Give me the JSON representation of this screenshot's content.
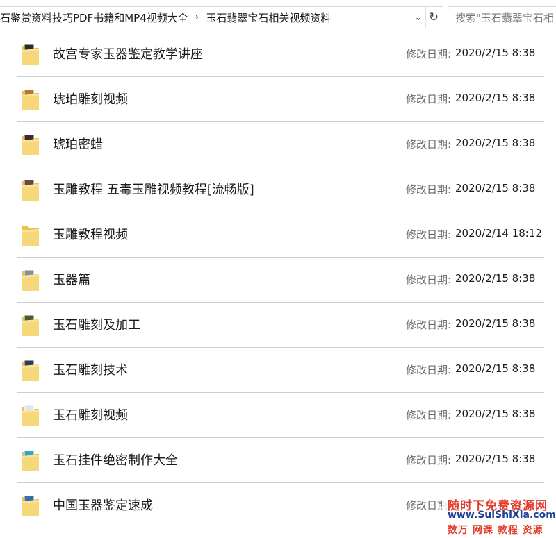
{
  "address_bar": {
    "breadcrumbs": [
      "石鉴赏资料技巧PDF书籍和MP4视频大全",
      "玉石翡翠宝石相关视频资料"
    ],
    "separator": "›",
    "dropdown_glyph": "⌄",
    "refresh_glyph": "↻"
  },
  "search": {
    "placeholder": "搜索\"玉石翡翠宝石相"
  },
  "file_list": {
    "modified_label": "修改日期:",
    "items": [
      {
        "name": "故宫专家玉器鉴定教学讲座",
        "modified": "2020/2/15 8:38",
        "icon": "folder-video-icon"
      },
      {
        "name": "琥珀雕刻视频",
        "modified": "2020/2/15 8:38",
        "icon": "folder-video-icon"
      },
      {
        "name": "琥珀密蜡",
        "modified": "2020/2/15 8:38",
        "icon": "folder-video-icon"
      },
      {
        "name": "玉雕教程 五毒玉雕视频教程[流畅版]",
        "modified": "2020/2/15 8:38",
        "icon": "folder-video-icon"
      },
      {
        "name": "玉雕教程视频",
        "modified": "2020/2/14 18:12",
        "icon": "folder-icon"
      },
      {
        "name": "玉器篇",
        "modified": "2020/2/15 8:38",
        "icon": "folder-image-icon"
      },
      {
        "name": "玉石雕刻及加工",
        "modified": "2020/2/15 8:38",
        "icon": "folder-video-icon"
      },
      {
        "name": "玉石雕刻技术",
        "modified": "2020/2/15 8:38",
        "icon": "folder-video-icon"
      },
      {
        "name": "玉石雕刻视频",
        "modified": "2020/2/15 8:38",
        "icon": "folder-doc-icon"
      },
      {
        "name": "玉石挂件绝密制作大全",
        "modified": "2020/2/15 8:38",
        "icon": "folder-video-icon"
      },
      {
        "name": "中国玉器鉴定速成",
        "modified": "",
        "icon": "folder-doc-icon"
      }
    ]
  },
  "watermark": {
    "line1": "随时下免费资源网",
    "line2": "www.SuiShiXia.com",
    "line3": "数万 网课 教程 资源"
  }
}
